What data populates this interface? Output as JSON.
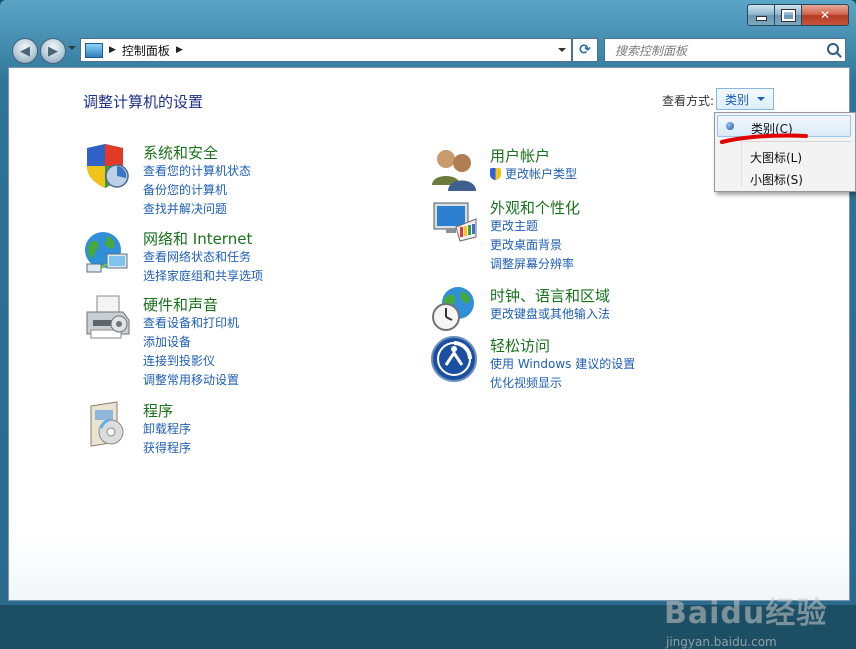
{
  "address": {
    "path": "控制面板"
  },
  "search": {
    "placeholder": "搜索控制面板"
  },
  "content": {
    "title": "调整计算机的设置",
    "view_label": "查看方式:",
    "view_value": "类别"
  },
  "categories": [
    {
      "title": "系统和安全",
      "links": [
        "查看您的计算机状态",
        "备份您的计算机",
        "查找并解决问题"
      ]
    },
    {
      "title": "网络和 Internet",
      "links": [
        "查看网络状态和任务",
        "选择家庭组和共享选项"
      ]
    },
    {
      "title": "硬件和声音",
      "links": [
        "查看设备和打印机",
        "添加设备",
        "连接到投影仪",
        "调整常用移动设置"
      ]
    },
    {
      "title": "程序",
      "links": [
        "卸载程序",
        "获得程序"
      ]
    },
    {
      "title": "用户帐户",
      "links": [
        "更改帐户类型"
      ]
    },
    {
      "title": "外观和个性化",
      "links": [
        "更改主题",
        "更改桌面背景",
        "调整屏幕分辨率"
      ]
    },
    {
      "title": "时钟、语言和区域",
      "links": [
        "更改键盘或其他输入法"
      ]
    },
    {
      "title": "轻松访问",
      "links": [
        "使用 Windows 建议的设置",
        "优化视频显示"
      ]
    }
  ],
  "view_menu": {
    "items": [
      {
        "label": "类别(C)",
        "selected": true
      },
      {
        "label": "大图标(L)",
        "selected": false
      },
      {
        "label": "小图标(S)",
        "selected": false
      }
    ]
  },
  "watermark": {
    "brand": "Baidu经验",
    "url": "jingyan.baidu.com"
  },
  "colors": {
    "category_title": "#19711c",
    "link": "#1f5fb4",
    "page_title": "#1e3287",
    "annotation": "#e00000"
  }
}
